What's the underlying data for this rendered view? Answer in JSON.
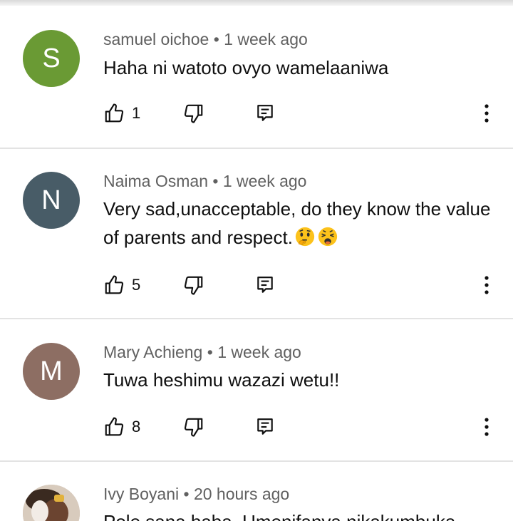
{
  "comments": [
    {
      "avatar_letter": "S",
      "avatar_color": "#6a9a34",
      "author": "samuel oichoe",
      "time": "1 week ago",
      "text": "Haha ni watoto ovyo wamelaaniwa",
      "likes": "1"
    },
    {
      "avatar_letter": "N",
      "avatar_color": "#485c67",
      "author": "Naima Osman",
      "time": "1 week ago",
      "text": "Very sad,unacceptable, do they know the value of parents and respect.",
      "likes": "5",
      "emojis": [
        "thinking-face",
        "weary-face"
      ]
    },
    {
      "avatar_letter": "M",
      "avatar_color": "#8d6e63",
      "author": "Mary Achieng",
      "time": "1 week ago",
      "text": "Tuwa heshimu wazazi wetu!!",
      "likes": "8"
    },
    {
      "avatar_image": "profile-photo",
      "author": "Ivy Boyani",
      "time": "20 hours ago",
      "text": "Pole sana baba. Umenifanya nikakumbuka"
    }
  ],
  "separator": " • ",
  "icons": {
    "like": "thumbs-up-icon",
    "dislike": "thumbs-down-icon",
    "reply": "reply-icon",
    "more": "more-vert-icon"
  },
  "colors": {
    "meta_text": "#606060",
    "body_text": "#0f0f0f",
    "divider": "#e3e3e3"
  }
}
